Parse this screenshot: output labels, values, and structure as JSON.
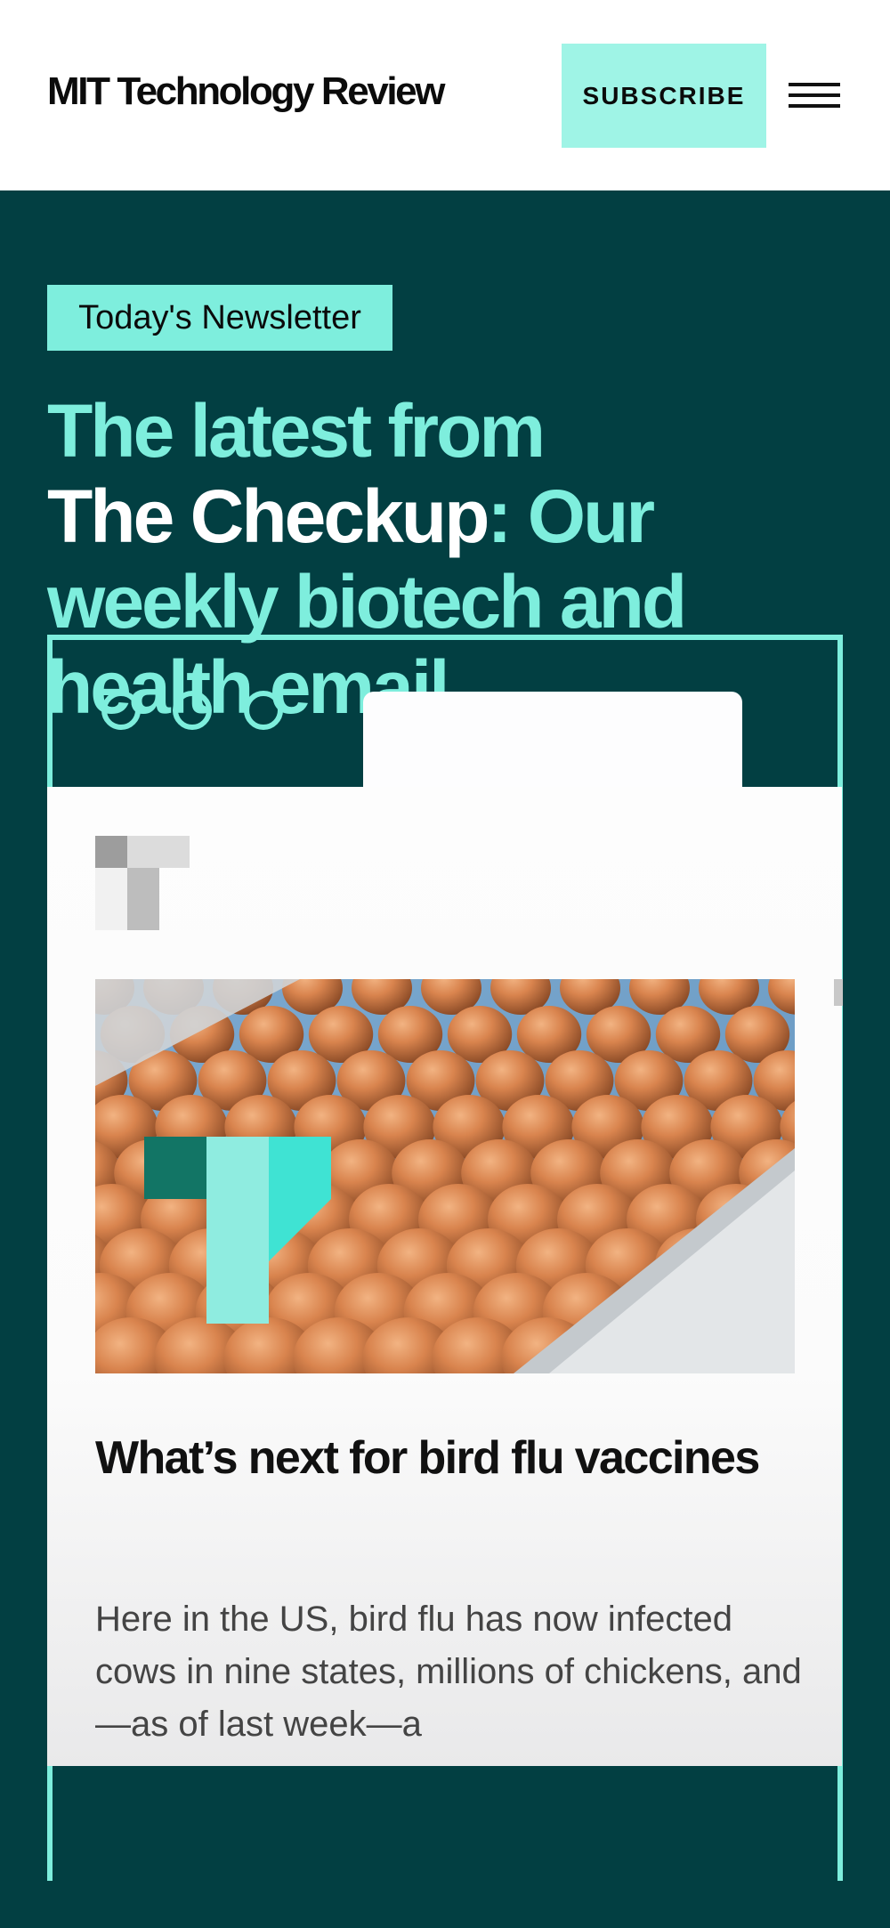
{
  "header": {
    "logo": "MIT Technology Review",
    "subscribe_label": "SUBSCRIBE",
    "menu_icon": "hamburger-menu-icon"
  },
  "hero": {
    "tag": "Today's Newsletter",
    "headline_part1": "The latest from",
    "headline_highlight": "The Checkup",
    "headline_part2": ": Our weekly biotech and health email"
  },
  "preview": {
    "card": {
      "title": "What’s next for bird flu vaccines",
      "body": "Here in the US, bird flu has now infected cows in nine states, millions of chickens, and—as of last week—a"
    }
  },
  "colors": {
    "background": "#023f42",
    "accent": "#7eeedd",
    "subscribe_button": "#9ff4e6",
    "header_bg": "#ffffff"
  }
}
